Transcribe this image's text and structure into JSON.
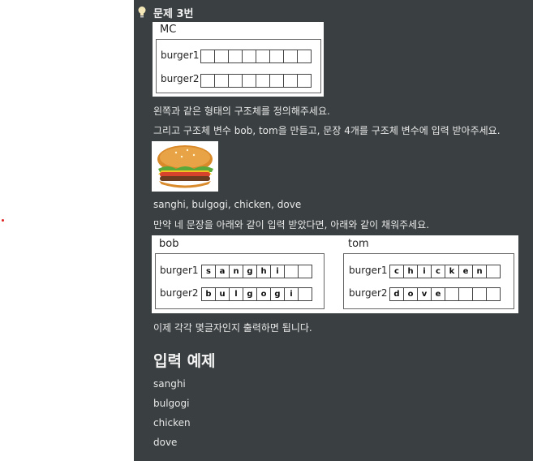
{
  "problem": {
    "title": "문제 3번",
    "struct_box": {
      "name": "MC",
      "rows": [
        "burger1",
        "burger2"
      ]
    },
    "line1": "왼쪽과 같은 형태의 구조체를 정의해주세요.",
    "line2": "그리고 구조체 변수 bob, tom을 만들고, 문장 4개를 구조체 변수에 입력 받아주세요.",
    "words_line": "sanghi, bulgogi, chicken, dove",
    "line3": "만약 네 문장을 아래와 같이 입력 받았다면, 아래와 같이 채워주세요.",
    "bob": {
      "name": "bob",
      "row1_label": "burger1",
      "row1": [
        "s",
        "a",
        "n",
        "g",
        "h",
        "i",
        "",
        ""
      ],
      "row2_label": "burger2",
      "row2": [
        "b",
        "u",
        "l",
        "g",
        "o",
        "g",
        "i",
        ""
      ]
    },
    "tom": {
      "name": "tom",
      "row1_label": "burger1",
      "row1": [
        "c",
        "h",
        "i",
        "c",
        "k",
        "e",
        "n",
        ""
      ],
      "row2_label": "burger2",
      "row2": [
        "d",
        "o",
        "v",
        "e",
        "",
        "",
        "",
        ""
      ]
    },
    "line4": "이제 각각 몇글자인지 출력하면 됩니다.",
    "input_heading": "입력 예제",
    "inputs": [
      "sanghi",
      "bulgogi",
      "chicken",
      "dove"
    ]
  },
  "colors": {
    "panel_bg": "#3a3f41",
    "accent_dot": "#e02020"
  },
  "icons": {
    "bulb": "lightbulb-icon",
    "burger": "hamburger-image"
  }
}
